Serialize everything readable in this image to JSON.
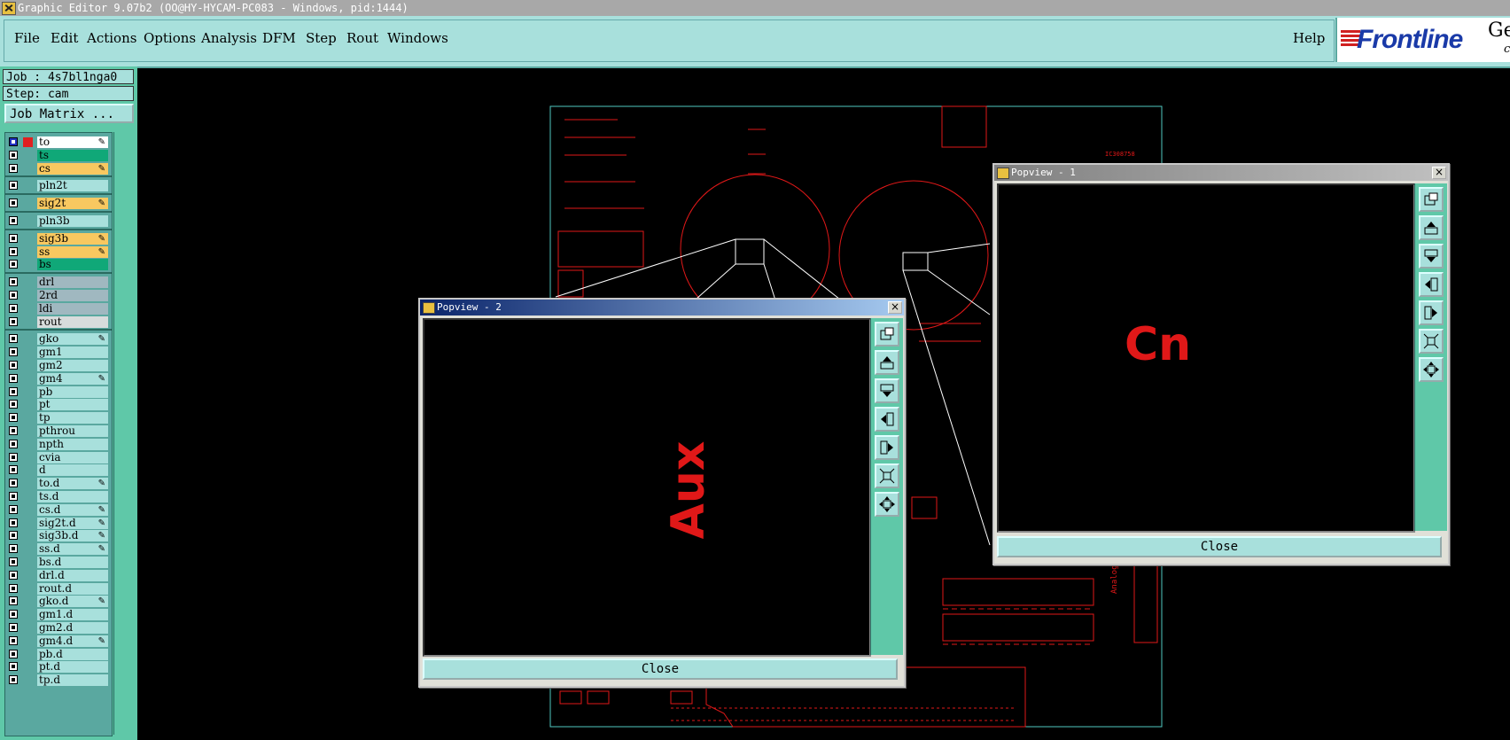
{
  "window": {
    "title": "Graphic Editor 9.07b2 (OO@HY-HYCAM-PC083 - Windows, pid:1444)"
  },
  "menu": {
    "items": [
      "File",
      "Edit",
      "Actions",
      "Options",
      "Analysis",
      "DFM",
      "Step",
      "Rout",
      "Windows"
    ],
    "help": "Help"
  },
  "logo": {
    "brand": "Frontline",
    "ge": "Ge",
    "gc": "c"
  },
  "job": {
    "job_line": "Job : 4s7bl1nga0",
    "step_line": "Step: cam",
    "matrix_button": "Job Matrix ..."
  },
  "layers": [
    {
      "name": "to",
      "color": "white",
      "pen": true,
      "selected": true
    },
    {
      "name": "ts",
      "color": "green"
    },
    {
      "name": "cs",
      "color": "orange",
      "pen": true
    },
    {
      "name": "pln2t",
      "color": "teal",
      "gapBefore": true
    },
    {
      "name": "sig2t",
      "color": "orange",
      "pen": true,
      "gapBefore": true
    },
    {
      "name": "pln3b",
      "color": "teal",
      "gapBefore": true
    },
    {
      "name": "sig3b",
      "color": "orange",
      "pen": true,
      "gapBefore": true
    },
    {
      "name": "ss",
      "color": "orange",
      "pen": true
    },
    {
      "name": "bs",
      "color": "green"
    },
    {
      "name": "drl",
      "color": "gray",
      "gapBefore": true
    },
    {
      "name": "2rd",
      "color": "gray"
    },
    {
      "name": "ldi",
      "color": "gray"
    },
    {
      "name": "rout",
      "color": "lgray"
    },
    {
      "name": "gko",
      "color": "teal",
      "pen": true,
      "gapBefore": true
    },
    {
      "name": "gm1",
      "color": "teal"
    },
    {
      "name": "gm2",
      "color": "teal"
    },
    {
      "name": "gm4",
      "color": "teal",
      "pen": true
    },
    {
      "name": "pb",
      "color": "teal"
    },
    {
      "name": "pt",
      "color": "teal"
    },
    {
      "name": "tp",
      "color": "teal"
    },
    {
      "name": "pthrou",
      "color": "teal"
    },
    {
      "name": "npth",
      "color": "teal"
    },
    {
      "name": "cvia",
      "color": "teal"
    },
    {
      "name": "d",
      "color": "teal"
    },
    {
      "name": "to.d",
      "color": "teal",
      "pen": true
    },
    {
      "name": "ts.d",
      "color": "teal"
    },
    {
      "name": "cs.d",
      "color": "teal",
      "pen": true
    },
    {
      "name": "sig2t.d",
      "color": "teal",
      "pen": true
    },
    {
      "name": "sig3b.d",
      "color": "teal",
      "pen": true
    },
    {
      "name": "ss.d",
      "color": "teal",
      "pen": true
    },
    {
      "name": "bs.d",
      "color": "teal"
    },
    {
      "name": "drl.d",
      "color": "teal"
    },
    {
      "name": "rout.d",
      "color": "teal"
    },
    {
      "name": "gko.d",
      "color": "teal",
      "pen": true
    },
    {
      "name": "gm1.d",
      "color": "teal"
    },
    {
      "name": "gm2.d",
      "color": "teal"
    },
    {
      "name": "gm4.d",
      "color": "teal",
      "pen": true
    },
    {
      "name": "pb.d",
      "color": "teal"
    },
    {
      "name": "pt.d",
      "color": "teal"
    },
    {
      "name": "tp.d",
      "color": "teal"
    }
  ],
  "popview1": {
    "title": "Popview - 1",
    "text": "Cn",
    "close": "Close"
  },
  "popview2": {
    "title": "Popview - 2",
    "text": "Aux",
    "close": "Close"
  },
  "board": {
    "small_text": "IC308758",
    "vertical_text": "Analog Inpu"
  },
  "colors": {
    "accent": "#a8e0dc",
    "panel": "#5fc8a8",
    "trace": "#e01818"
  }
}
